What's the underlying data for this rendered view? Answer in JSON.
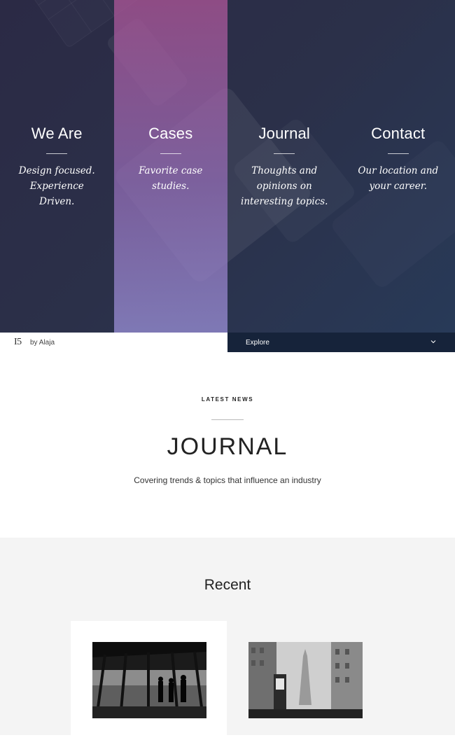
{
  "hero": {
    "columns": [
      {
        "title": "We Are",
        "subtitle": "Design focused. Experience Driven."
      },
      {
        "title": "Cases",
        "subtitle": "Favorite case studies."
      },
      {
        "title": "Journal",
        "subtitle": "Thoughts and opinions on interesting topics."
      },
      {
        "title": "Contact",
        "subtitle": "Our location and your career."
      }
    ]
  },
  "bar": {
    "logo": "I5",
    "byline": "by Alaja",
    "explore_label": "Explore",
    "explore_icon": "chevron-down-icon"
  },
  "news": {
    "kicker": "LATEST NEWS",
    "title": "JOURNAL",
    "subtitle": "Covering trends & topics that influence an industry"
  },
  "recent": {
    "title": "Recent",
    "cards": [
      {
        "image": "office-window-silhouettes-photo"
      },
      {
        "image": "city-street-photo"
      }
    ]
  },
  "colors": {
    "hero_base": "#2b2f4a",
    "active_column": "#a85a9e",
    "explore_bar": "#16233a",
    "recent_bg": "#f4f4f4"
  }
}
